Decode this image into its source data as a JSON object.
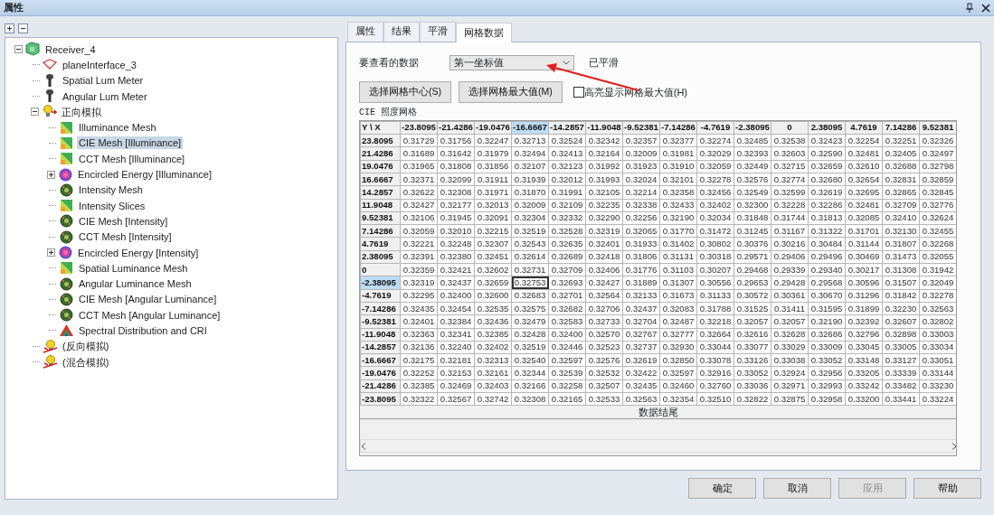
{
  "window": {
    "title": "属性"
  },
  "tree": [
    {
      "label": "Receiver_4",
      "kind": "receiver",
      "expanded": true,
      "selected": false,
      "children": [
        {
          "label": "planeInterface_3",
          "kind": "plane",
          "selected": false
        },
        {
          "label": "Spatial Lum Meter",
          "kind": "meter",
          "selected": false
        },
        {
          "label": "Angular Lum Meter",
          "kind": "meter",
          "selected": false
        },
        {
          "label": "正向模拟",
          "kind": "bulb",
          "expanded": true,
          "selected": false,
          "children": [
            {
              "label": "Illuminance Mesh",
              "kind": "mesh",
              "selected": false
            },
            {
              "label": "CIE Mesh [Illuminance]",
              "kind": "mesh",
              "selected": true
            },
            {
              "label": "CCT Mesh [Illuminance]",
              "kind": "mesh",
              "selected": false
            },
            {
              "label": "Encircled Energy [Illuminance]",
              "kind": "target",
              "expanded": false,
              "selected": false
            },
            {
              "label": "Intensity Mesh",
              "kind": "sphere",
              "selected": false
            },
            {
              "label": "Intensity Slices",
              "kind": "mesh",
              "selected": false
            },
            {
              "label": "CIE Mesh [Intensity]",
              "kind": "sphere",
              "selected": false
            },
            {
              "label": "CCT Mesh [Intensity]",
              "kind": "sphere",
              "selected": false
            },
            {
              "label": "Encircled Energy [Intensity]",
              "kind": "target",
              "expanded": false,
              "selected": false
            },
            {
              "label": "Spatial Luminance Mesh",
              "kind": "mesh",
              "selected": false
            },
            {
              "label": "Angular Luminance Mesh",
              "kind": "sphere",
              "selected": false
            },
            {
              "label": "CIE Mesh [Angular Luminance]",
              "kind": "sphere",
              "selected": false
            },
            {
              "label": "CCT Mesh [Angular Luminance]",
              "kind": "sphere",
              "selected": false
            },
            {
              "label": "Spectral Distribution and CRI",
              "kind": "spectrum",
              "selected": false
            }
          ]
        },
        {
          "label": "(反向模拟)",
          "kind": "bulb-off",
          "selected": false
        },
        {
          "label": "(混合模拟)",
          "kind": "bulb-off",
          "selected": false
        }
      ]
    }
  ],
  "tabs": [
    {
      "label": "属性",
      "selected": false
    },
    {
      "label": "结果",
      "selected": false
    },
    {
      "label": "平滑",
      "selected": false
    },
    {
      "label": "网格数据",
      "selected": true
    }
  ],
  "data_select": {
    "label": "要查看的数据",
    "value": "第一坐标值",
    "status": "已平滑"
  },
  "buttons": [
    "选择网格中心(S)",
    "选择网格最大值(M)"
  ],
  "highlight_checkbox": {
    "label": "高亮显示网格最大值(H)",
    "checked": false
  },
  "grid_caption": "CIE 照度网格",
  "table": {
    "corner": "Y \\ X",
    "columns": [
      {
        "label": "-23.8095",
        "selected": false
      },
      {
        "label": "-21.4286",
        "selected": false
      },
      {
        "label": "-19.0476",
        "selected": false
      },
      {
        "label": "-16.6667",
        "selected": true
      },
      {
        "label": "-14.2857",
        "selected": false
      },
      {
        "label": "-11.9048",
        "selected": false
      },
      {
        "label": "-9.52381",
        "selected": false
      },
      {
        "label": "-7.14286",
        "selected": false
      },
      {
        "label": "-4.7619",
        "selected": false
      },
      {
        "label": "-2.38095",
        "selected": false
      },
      {
        "label": "0",
        "selected": false
      },
      {
        "label": "2.38095",
        "selected": false
      },
      {
        "label": "4.7619",
        "selected": false
      },
      {
        "label": "7.14286",
        "selected": false
      },
      {
        "label": "9.52381",
        "selected": false
      }
    ],
    "rows": [
      {
        "label": "23.8095",
        "selected": false,
        "cells": [
          "0.31729",
          "0.31756",
          "0.32247",
          "0.32713",
          "0.32524",
          "0.32342",
          "0.32357",
          "0.32377",
          "0.32274",
          "0.32485",
          "0.32538",
          "0.32423",
          "0.32254",
          "0.32251",
          "0.32326"
        ]
      },
      {
        "label": "21.4286",
        "selected": false,
        "cells": [
          "0.31689",
          "0.31642",
          "0.31979",
          "0.32494",
          "0.32413",
          "0.32164",
          "0.32009",
          "0.31981",
          "0.32029",
          "0.32393",
          "0.32603",
          "0.32590",
          "0.32481",
          "0.32405",
          "0.32497"
        ]
      },
      {
        "label": "19.0476",
        "selected": false,
        "cells": [
          "0.31965",
          "0.31808",
          "0.31856",
          "0.32107",
          "0.32123",
          "0.31992",
          "0.31923",
          "0.31910",
          "0.32059",
          "0.32449",
          "0.32715",
          "0.32659",
          "0.32610",
          "0.32688",
          "0.32798"
        ]
      },
      {
        "label": "16.6667",
        "selected": false,
        "cells": [
          "0.32371",
          "0.32099",
          "0.31911",
          "0.31939",
          "0.32012",
          "0.31993",
          "0.32024",
          "0.32101",
          "0.32278",
          "0.32576",
          "0.32774",
          "0.32680",
          "0.32654",
          "0.32831",
          "0.32859"
        ]
      },
      {
        "label": "14.2857",
        "selected": false,
        "cells": [
          "0.32622",
          "0.32308",
          "0.31971",
          "0.31870",
          "0.31991",
          "0.32105",
          "0.32214",
          "0.32358",
          "0.32456",
          "0.32549",
          "0.32599",
          "0.32619",
          "0.32695",
          "0.32865",
          "0.32845"
        ]
      },
      {
        "label": "11.9048",
        "selected": false,
        "cells": [
          "0.32427",
          "0.32177",
          "0.32013",
          "0.32009",
          "0.32109",
          "0.32235",
          "0.32338",
          "0.32433",
          "0.32402",
          "0.32300",
          "0.32228",
          "0.32286",
          "0.32481",
          "0.32709",
          "0.32776"
        ]
      },
      {
        "label": "9.52381",
        "selected": false,
        "cells": [
          "0.32106",
          "0.31945",
          "0.32091",
          "0.32304",
          "0.32332",
          "0.32290",
          "0.32256",
          "0.32190",
          "0.32034",
          "0.31848",
          "0.31744",
          "0.31813",
          "0.32085",
          "0.32410",
          "0.32624"
        ]
      },
      {
        "label": "7.14286",
        "selected": false,
        "cells": [
          "0.32059",
          "0.32010",
          "0.32215",
          "0.32519",
          "0.32528",
          "0.32319",
          "0.32065",
          "0.31770",
          "0.31472",
          "0.31245",
          "0.31167",
          "0.31322",
          "0.31701",
          "0.32130",
          "0.32455"
        ]
      },
      {
        "label": "4.7619",
        "selected": false,
        "cells": [
          "0.32221",
          "0.32248",
          "0.32307",
          "0.32543",
          "0.32635",
          "0.32401",
          "0.31933",
          "0.31402",
          "0.30802",
          "0.30376",
          "0.30216",
          "0.30484",
          "0.31144",
          "0.31807",
          "0.32268"
        ]
      },
      {
        "label": "2.38095",
        "selected": false,
        "cells": [
          "0.32391",
          "0.32380",
          "0.32451",
          "0.32614",
          "0.32689",
          "0.32418",
          "0.31806",
          "0.31131",
          "0.30318",
          "0.29571",
          "0.29406",
          "0.29496",
          "0.30469",
          "0.31473",
          "0.32055"
        ]
      },
      {
        "label": "0",
        "selected": false,
        "cells": [
          "0.32359",
          "0.32421",
          "0.32602",
          "0.32731",
          "0.32709",
          "0.32406",
          "0.31776",
          "0.31103",
          "0.30207",
          "0.29468",
          "0.29339",
          "0.29340",
          "0.30217",
          "0.31308",
          "0.31942"
        ]
      },
      {
        "label": "-2.38095",
        "selected": true,
        "cells": [
          "0.32319",
          "0.32437",
          "0.32659",
          "0.32753",
          "0.32693",
          "0.32427",
          "0.31889",
          "0.31307",
          "0.30556",
          "0.29653",
          "0.29428",
          "0.29568",
          "0.30596",
          "0.31507",
          "0.32049"
        ]
      },
      {
        "label": "-4.7619",
        "selected": false,
        "cells": [
          "0.32295",
          "0.32400",
          "0.32600",
          "0.32683",
          "0.32701",
          "0.32564",
          "0.32133",
          "0.31673",
          "0.31133",
          "0.30572",
          "0.30361",
          "0.30670",
          "0.31296",
          "0.31842",
          "0.32278"
        ]
      },
      {
        "label": "-7.14286",
        "selected": false,
        "cells": [
          "0.32435",
          "0.32454",
          "0.32535",
          "0.32575",
          "0.32682",
          "0.32706",
          "0.32437",
          "0.32083",
          "0.31788",
          "0.31525",
          "0.31411",
          "0.31595",
          "0.31899",
          "0.32230",
          "0.32563"
        ]
      },
      {
        "label": "-9.52381",
        "selected": false,
        "cells": [
          "0.32401",
          "0.32384",
          "0.32436",
          "0.32479",
          "0.32583",
          "0.32733",
          "0.32704",
          "0.32487",
          "0.32218",
          "0.32057",
          "0.32057",
          "0.32190",
          "0.32392",
          "0.32607",
          "0.32802"
        ]
      },
      {
        "label": "-11.9048",
        "selected": false,
        "cells": [
          "0.32363",
          "0.32341",
          "0.32385",
          "0.32428",
          "0.32400",
          "0.32570",
          "0.32767",
          "0.32777",
          "0.32664",
          "0.32616",
          "0.32628",
          "0.32686",
          "0.32796",
          "0.32898",
          "0.33003"
        ]
      },
      {
        "label": "-14.2857",
        "selected": false,
        "cells": [
          "0.32136",
          "0.32240",
          "0.32402",
          "0.32519",
          "0.32446",
          "0.32523",
          "0.32737",
          "0.32930",
          "0.33044",
          "0.33077",
          "0.33029",
          "0.33009",
          "0.33045",
          "0.33005",
          "0.33034"
        ]
      },
      {
        "label": "-16.6667",
        "selected": false,
        "cells": [
          "0.32175",
          "0.32181",
          "0.32313",
          "0.32540",
          "0.32597",
          "0.32576",
          "0.32619",
          "0.32850",
          "0.33078",
          "0.33126",
          "0.33038",
          "0.33052",
          "0.33148",
          "0.33127",
          "0.33051"
        ]
      },
      {
        "label": "-19.0476",
        "selected": false,
        "cells": [
          "0.32252",
          "0.32153",
          "0.32161",
          "0.32344",
          "0.32539",
          "0.32532",
          "0.32422",
          "0.32597",
          "0.32916",
          "0.33052",
          "0.32924",
          "0.32956",
          "0.33205",
          "0.33339",
          "0.33144"
        ]
      },
      {
        "label": "-21.4286",
        "selected": false,
        "cells": [
          "0.32385",
          "0.32469",
          "0.32403",
          "0.32166",
          "0.32258",
          "0.32507",
          "0.32435",
          "0.32460",
          "0.32760",
          "0.33036",
          "0.32971",
          "0.32993",
          "0.33242",
          "0.33482",
          "0.33230"
        ]
      },
      {
        "label": "-23.8095",
        "selected": false,
        "cells": [
          "0.32322",
          "0.32567",
          "0.32742",
          "0.32308",
          "0.32165",
          "0.32533",
          "0.32563",
          "0.32354",
          "0.32510",
          "0.32822",
          "0.32875",
          "0.32958",
          "0.33200",
          "0.33441",
          "0.33224"
        ]
      }
    ],
    "end_label": "数据结尾"
  },
  "footer_buttons": [
    {
      "label": "确定",
      "disabled": false
    },
    {
      "label": "取消",
      "disabled": false
    },
    {
      "label": "应用",
      "disabled": true
    },
    {
      "label": "帮助",
      "disabled": false
    }
  ],
  "annotations": [
    {
      "kind": "arrow"
    }
  ]
}
